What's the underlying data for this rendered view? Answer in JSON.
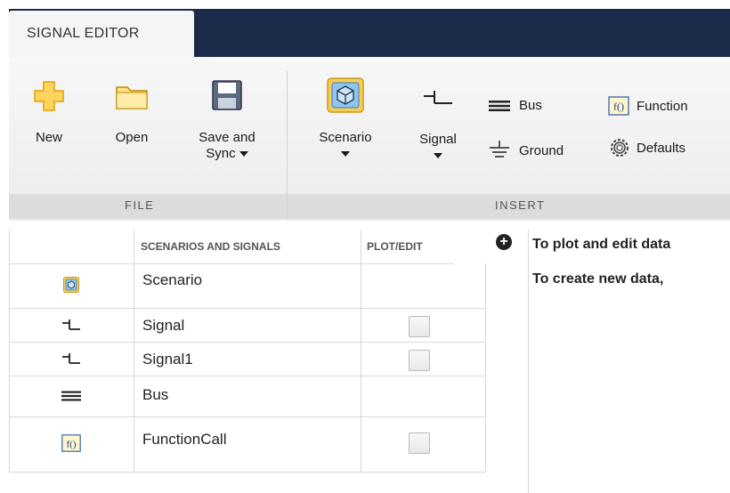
{
  "tab": {
    "label": "SIGNAL EDITOR"
  },
  "ribbon": {
    "file": {
      "group_label": "FILE",
      "new_label": "New",
      "open_label": "Open",
      "save_label_line1": "Save and",
      "save_label_line2": "Sync"
    },
    "insert": {
      "group_label": "INSERT",
      "scenario_label": "Scenario",
      "signal_label": "Signal",
      "bus_label": "Bus",
      "ground_label": "Ground",
      "function_label": "Function",
      "defaults_label": "Defaults"
    }
  },
  "table": {
    "headers": {
      "name": "SCENARIOS AND SIGNALS",
      "plot": "PLOT/EDIT"
    },
    "rows": [
      {
        "icon": "scenario-icon",
        "label": "Scenario",
        "has_checkbox": false
      },
      {
        "icon": "signal-icon",
        "label": "Signal",
        "has_checkbox": true
      },
      {
        "icon": "signal-icon",
        "label": "Signal1",
        "has_checkbox": true
      },
      {
        "icon": "bus-icon",
        "label": "Bus",
        "has_checkbox": false
      },
      {
        "icon": "function-icon",
        "label": "FunctionCall",
        "has_checkbox": true
      }
    ]
  },
  "panel": {
    "line1": "To plot and edit data",
    "line2": "To create new data,"
  },
  "colors": {
    "tabbar": "#1b2c4a",
    "ribbon_bg": "#f2f2f2",
    "footer_bg": "#dcdcdc"
  }
}
